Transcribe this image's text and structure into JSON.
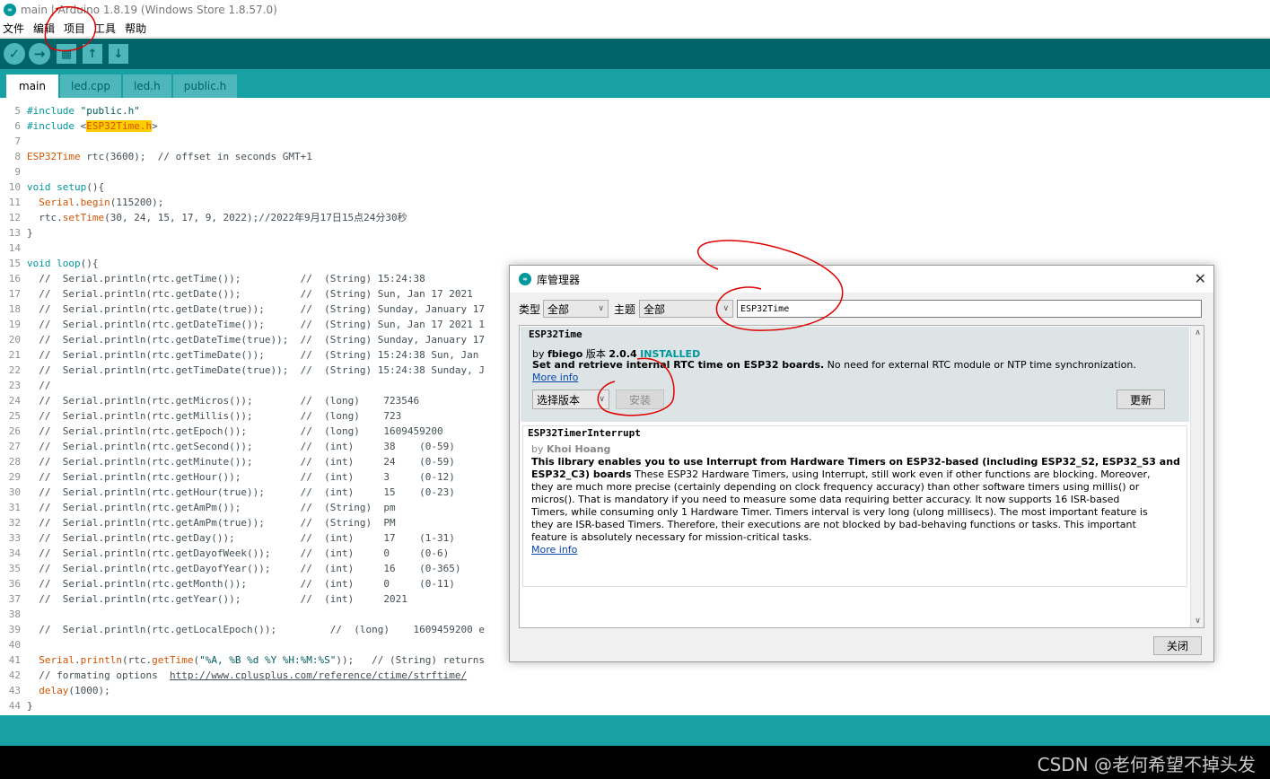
{
  "window": {
    "title": "main | Arduino 1.8.19 (Windows Store 1.8.57.0)"
  },
  "menu": [
    "文件",
    "编辑",
    "项目",
    "工具",
    "帮助"
  ],
  "toolbar": {
    "verify": "✓",
    "upload": "→",
    "new": "▦",
    "open": "↑",
    "save": "↓"
  },
  "tabs": [
    "main",
    "led.cpp",
    "led.h",
    "public.h"
  ],
  "editor": {
    "line_numbers": [
      "5",
      "6",
      "7",
      "8",
      "9",
      "10",
      "11",
      "12",
      "13",
      "14",
      "15",
      "16",
      "17",
      "18",
      "19",
      "20",
      "21",
      "22",
      "23",
      "24",
      "25",
      "26",
      "27",
      "28",
      "29",
      "30",
      "31",
      "32",
      "33",
      "34",
      "35",
      "36",
      "37",
      "38",
      "39",
      "40",
      "41",
      "42",
      "43",
      "44"
    ]
  },
  "dialog": {
    "title": "库管理器",
    "type_label": "类型",
    "type_value": "全部",
    "topic_label": "主题",
    "topic_value": "全部",
    "search_value": "ESP32Time",
    "item1": {
      "name": "ESP32Time",
      "by": "by",
      "author": "fbiego",
      "version_label": "版本",
      "version": "2.0.4",
      "status": "INSTALLED",
      "desc_bold": "Set and retrieve internal RTC time on ESP32 boards.",
      "desc": " No need for external RTC module or NTP time synchronization.",
      "more_info": "More info",
      "version_select": "选择版本",
      "install_button": "安装",
      "update_button": "更新"
    },
    "item2": {
      "name": "ESP32TimerInterrupt",
      "by": "by",
      "author": "Khoi Hoang",
      "desc_l1_bold": "This library enables you to use Interrupt from Hardware Timers on ESP32-based (including ESP32_S2, ESP32_S3 and",
      "desc_l2_bold": "ESP32_C3) boards",
      "desc_l2": " These ESP32 Hardware Timers, using Interrupt, still work even if other functions are blocking. Moreover,",
      "desc_l3": "they are much more precise (certainly depending on clock frequency accuracy) than other software timers using millis() or",
      "desc_l4": "micros(). That is mandatory if you need to measure some data requiring better accuracy. It now supports 16 ISR-based",
      "desc_l5": "Timers, while consuming only 1 Hardware Timer. Timers interval is very long (ulong millisecs). The most important feature is",
      "desc_l6": "they are ISR-based Timers. Therefore, their executions are not blocked by bad-behaving functions or tasks. This important",
      "desc_l7": "feature is absolutely necessary for mission-critical tasks.",
      "more_info": "More info"
    },
    "close_button": "关闭"
  },
  "watermark": "CSDN @老何希望不掉头发",
  "colors": {
    "teal_dark": "#006468",
    "teal": "#17a1a5",
    "highlight": "#ffcc00",
    "annotation": "#e00000"
  }
}
